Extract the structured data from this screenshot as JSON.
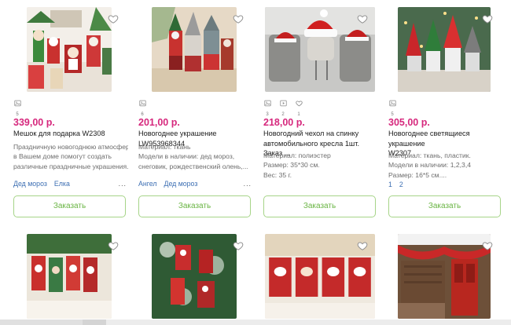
{
  "products": [
    {
      "id_label": "p1",
      "image_icon": "stockings-gifts-photo",
      "meta": [
        {
          "icon": "image-icon",
          "count": "5"
        }
      ],
      "price": "339,00 р.",
      "title_lines": [
        "Мешок для подарка W2308"
      ],
      "desc_lines": [
        "Праздничную новогоднюю атмосферу",
        "в Вашем доме помогут создать",
        "различные праздничные украшения...."
      ],
      "tags": [
        "Дед мороз",
        "Елка"
      ],
      "more": "...",
      "button": "Заказать"
    },
    {
      "id_label": "p2",
      "image_icon": "gnome-figures-photo",
      "meta": [
        {
          "icon": "image-icon",
          "count": "6"
        }
      ],
      "price": "201,00 р.",
      "title_lines": [
        "Новогоднее украшение LW953968344"
      ],
      "desc_lines": [
        "Материал: ткань",
        "Модели в наличии: дед мороз,",
        "снеговик, рождественский олень,..."
      ],
      "tags": [
        "Ангел",
        "Дед мороз"
      ],
      "more": "...",
      "button": "Заказать"
    },
    {
      "id_label": "p3",
      "image_icon": "car-seat-cover-photo",
      "meta": [
        {
          "icon": "image-icon",
          "count": "3"
        },
        {
          "icon": "video-icon",
          "count": "2"
        },
        {
          "icon": "heart-icon",
          "count": "1"
        }
      ],
      "price": "218,00 р.",
      "title_lines": [
        "Новогодний чехол на спинку",
        "автомобильного кресла 1шт. Заказ ..."
      ],
      "desc_lines": [
        "Материал: полиэстер",
        "Размер: 35*30 см.",
        "Вес: 35 г."
      ],
      "tags": [],
      "more": "",
      "button": "Заказать"
    },
    {
      "id_label": "p4",
      "image_icon": "glowing-gnomes-photo",
      "meta": [
        {
          "icon": "image-icon",
          "count": "5"
        }
      ],
      "price": "305,00 р.",
      "title_lines": [
        "Новогоднее светящиеся украшение",
        "W2307"
      ],
      "desc_lines": [
        "Материал: ткань, пластик.",
        "Модели в наличии: 1,2,3,4",
        "Размер: 16*5 см...."
      ],
      "tags": [
        "1",
        "2"
      ],
      "more": "",
      "button": "Заказать"
    }
  ],
  "row2": [
    {
      "image_icon": "stockings-on-mantel-photo"
    },
    {
      "image_icon": "christmas-tree-stockings-photo"
    },
    {
      "image_icon": "snowman-stockings-photo"
    },
    {
      "image_icon": "door-decoration-photo"
    }
  ],
  "colors": {
    "price": "#d6287d",
    "button_text": "#6ab544",
    "button_border": "#a6d488",
    "tag": "#3d6fb3"
  }
}
